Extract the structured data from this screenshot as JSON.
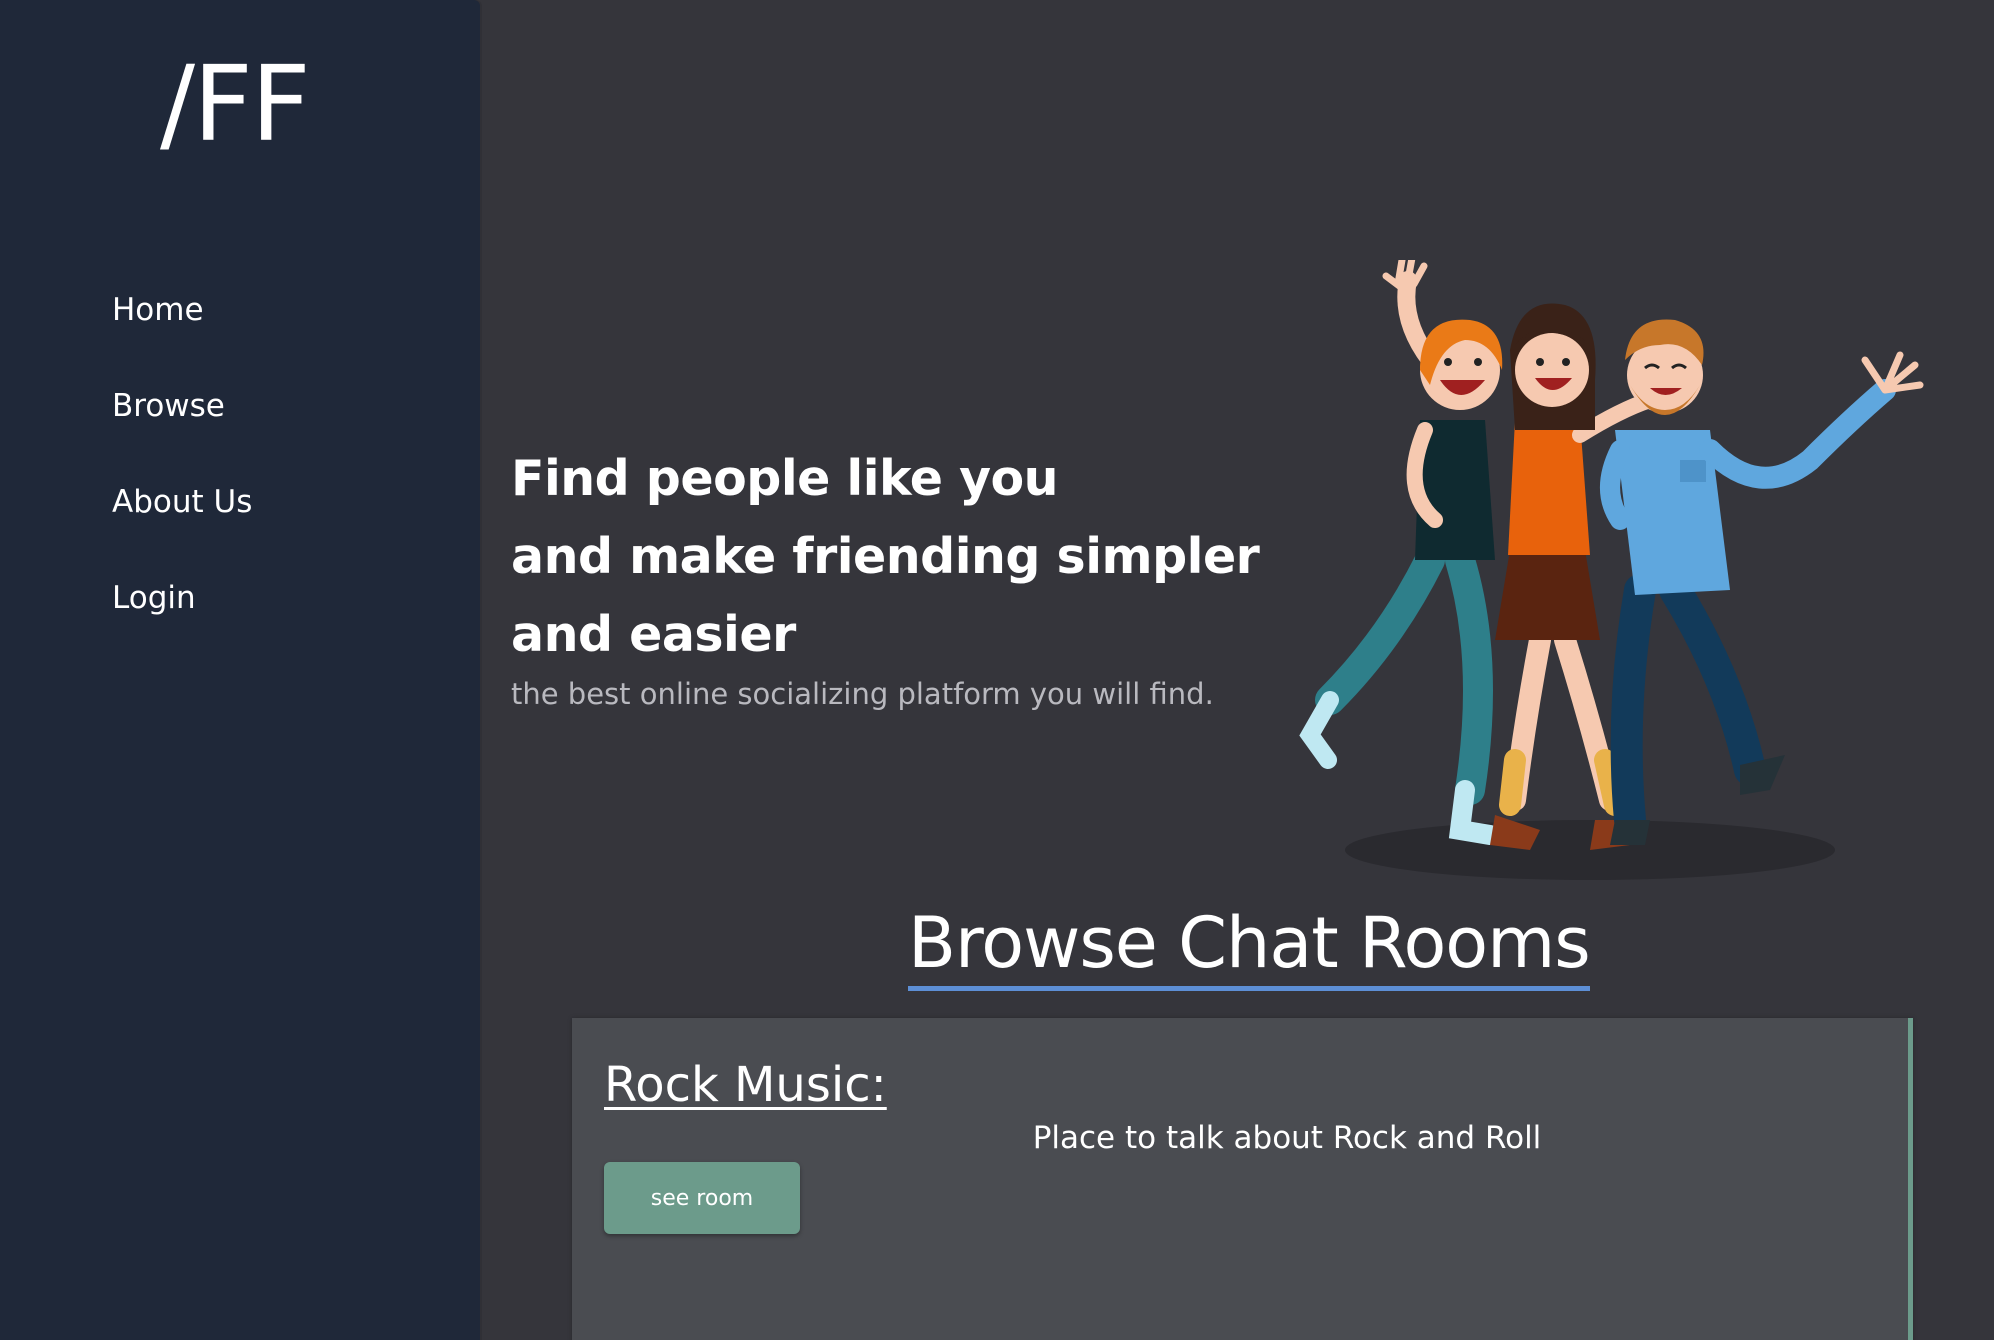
{
  "sidebar": {
    "logo": "/FF",
    "items": [
      {
        "label": "Home"
      },
      {
        "label": "Browse"
      },
      {
        "label": "About Us"
      },
      {
        "label": "Login"
      }
    ]
  },
  "hero": {
    "title_lines": [
      "Find people like you",
      "and make friending simpler",
      "and easier"
    ],
    "subtitle": "the best online socializing platform you will find."
  },
  "browse": {
    "title": "Browse Chat Rooms",
    "rooms": [
      {
        "name": "Rock Music:",
        "description": "Place to talk about Rock and Roll",
        "button_label": "see room"
      }
    ]
  },
  "colors": {
    "sidebar_bg": "#1f2839",
    "page_bg": "#35353b",
    "card_bg": "#4a4c51",
    "accent_green": "#6c9b8b",
    "title_underline": "#5d8fd6"
  }
}
